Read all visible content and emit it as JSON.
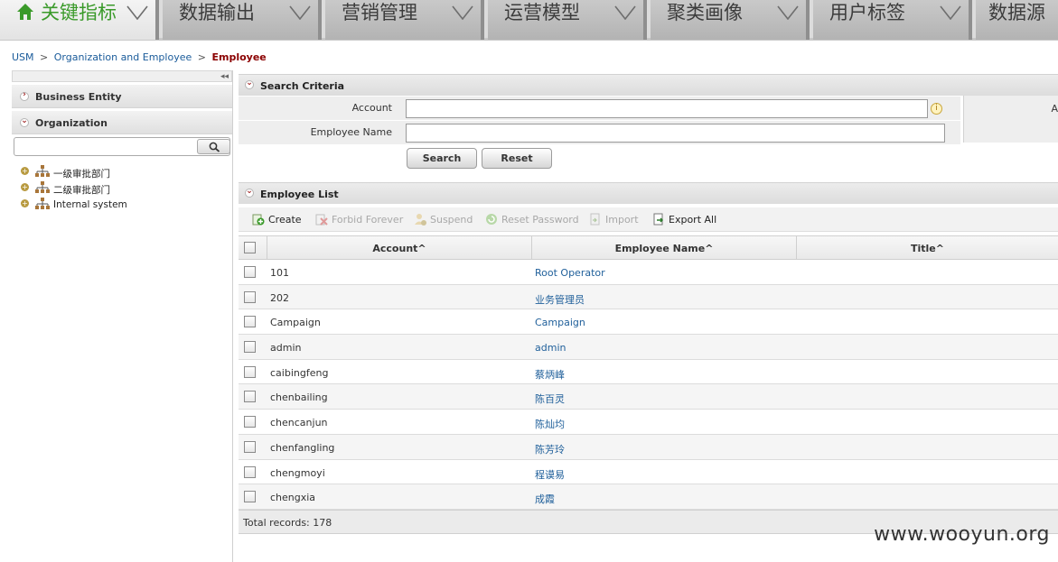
{
  "nav": {
    "items": [
      {
        "label": "关键指标"
      },
      {
        "label": "数据输出"
      },
      {
        "label": "营销管理"
      },
      {
        "label": "运营模型"
      },
      {
        "label": "聚类画像"
      },
      {
        "label": "用户标签"
      },
      {
        "label": "数据源"
      }
    ]
  },
  "breadcrumb": {
    "root": "USM",
    "sep": ">",
    "section": "Organization and Employee",
    "current": "Employee"
  },
  "sidebar": {
    "business_entity": "Business Entity",
    "organization": "Organization",
    "tree": [
      {
        "label": "一级审批部门"
      },
      {
        "label": "二级审批部门"
      },
      {
        "label": "Internal system"
      }
    ]
  },
  "search_criteria": {
    "title": "Search Criteria",
    "account_label": "Account",
    "account_value": "",
    "employee_name_label": "Employee Name",
    "employee_name_value": "",
    "side_label": "A",
    "search_button": "Search",
    "reset_button": "Reset"
  },
  "employee_list": {
    "title": "Employee List",
    "toolbar": {
      "create": "Create",
      "forbid_forever": "Forbid Forever",
      "suspend": "Suspend",
      "reset_password": "Reset Password",
      "import": "Import",
      "export_all": "Export All"
    },
    "columns": {
      "account": "Account^",
      "employee_name": "Employee Name^",
      "title": "Title^"
    },
    "rows": [
      {
        "account": "101",
        "name": "Root Operator"
      },
      {
        "account": "202",
        "name": "业务管理员"
      },
      {
        "account": "Campaign",
        "name": "Campaign"
      },
      {
        "account": "admin",
        "name": "admin"
      },
      {
        "account": "caibingfeng",
        "name": "蔡炳峰"
      },
      {
        "account": "chenbailing",
        "name": "陈百灵"
      },
      {
        "account": "chencanjun",
        "name": "陈灿均"
      },
      {
        "account": "chenfangling",
        "name": "陈芳玲"
      },
      {
        "account": "chengmoyi",
        "name": "程谟易"
      },
      {
        "account": "chengxia",
        "name": "成霞"
      }
    ],
    "total": "Total records: 178"
  },
  "watermark": "www.wooyun.org",
  "colors": {
    "active_nav": "#3a9a2a",
    "link": "#1f5f9a",
    "breadcrumb_current": "#8b0000"
  }
}
